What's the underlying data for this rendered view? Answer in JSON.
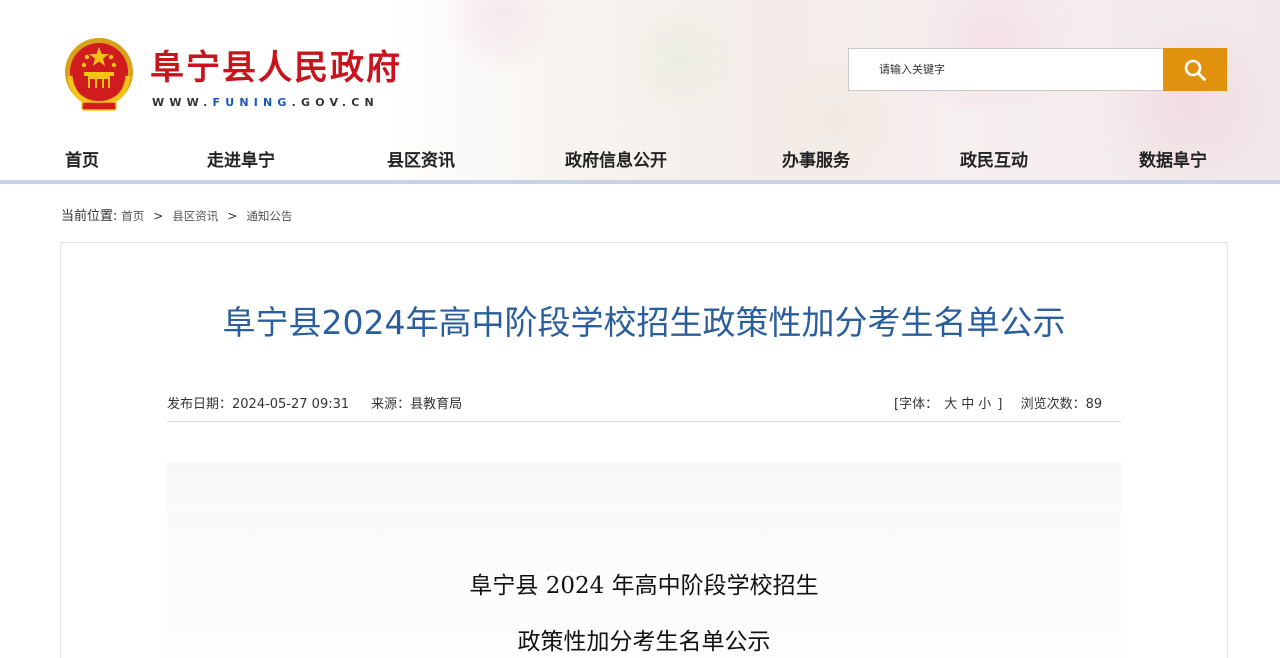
{
  "header": {
    "site_title": "阜宁县人民政府",
    "site_url_prefix": "WWW.",
    "site_url_highlight": "FUNING",
    "site_url_suffix": ".GOV.CN",
    "search_placeholder": "请输入关键字",
    "search_button_icon": "search-icon",
    "emblem_icon": "national-emblem-icon"
  },
  "nav": {
    "items": [
      "首页",
      "走进阜宁",
      "县区资讯",
      "政府信息公开",
      "办事服务",
      "政民互动",
      "数据阜宁"
    ]
  },
  "breadcrumb": {
    "label": "当前位置:",
    "items": [
      "首页",
      "县区资讯",
      "通知公告"
    ],
    "separator": ">"
  },
  "article": {
    "title": "阜宁县2024年高中阶段学校招生政策性加分考生名单公示",
    "publish_date": "发布日期：2024-05-27 09:31",
    "source": "来源：县教育局",
    "font_label_open": "[字体：",
    "font_sizes": [
      "大",
      "中",
      "小"
    ],
    "font_label_close": "]",
    "views": "浏览次数：89",
    "doc_lines": [
      "阜宁县 2024 年高中阶段学校招生",
      "政策性加分考生名单公示"
    ]
  },
  "colors": {
    "brand_red": "#c8151d",
    "search_orange": "#e0920f",
    "title_blue": "#2b5e9c",
    "url_blue": "#1a57b4"
  }
}
